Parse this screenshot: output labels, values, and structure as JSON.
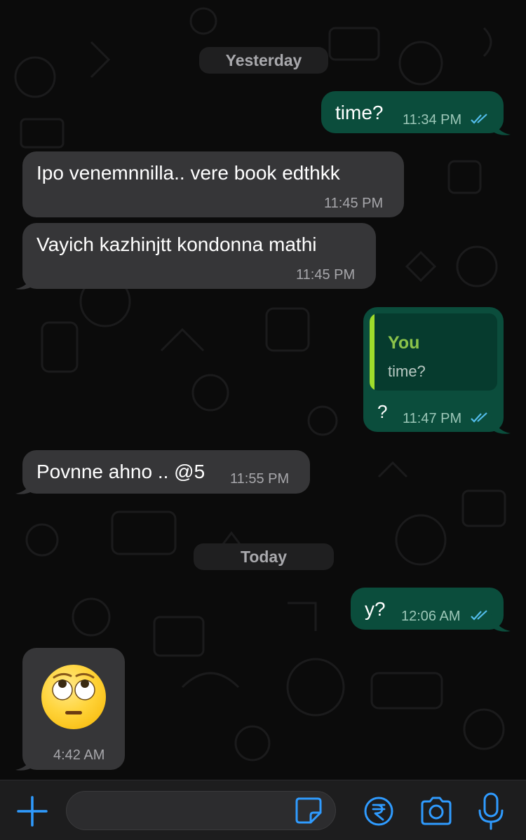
{
  "chat": {
    "date_separators": {
      "yesterday": "Yesterday",
      "today": "Today"
    },
    "messages": [
      {
        "direction": "outgoing",
        "text": "time?",
        "time": "11:34 PM",
        "status": "read"
      },
      {
        "direction": "incoming",
        "text": "Ipo venemnnilla.. vere book edthkk",
        "time": "11:45 PM"
      },
      {
        "direction": "incoming",
        "text": "Vayich kazhinjtt kondonna mathi",
        "time": "11:45 PM"
      },
      {
        "direction": "outgoing",
        "quote": {
          "author": "You",
          "text": "time?"
        },
        "text": "?",
        "time": "11:47 PM",
        "status": "read"
      },
      {
        "direction": "incoming",
        "text": "Povnne ahno .. @5",
        "time": "11:55 PM"
      },
      {
        "direction": "outgoing",
        "text": "y?",
        "time": "12:06 AM",
        "status": "read"
      },
      {
        "direction": "incoming",
        "emoji": "face-with-rolling-eyes",
        "time": "4:42 AM"
      }
    ]
  },
  "composer": {
    "input_value": "",
    "icons": [
      "plus-icon",
      "sticker-icon",
      "rupee-payment-icon",
      "camera-icon",
      "microphone-icon"
    ]
  },
  "colors": {
    "background": "#0b0b0b",
    "incoming_bubble": "#363638",
    "outgoing_bubble": "#0b4d3c",
    "read_ticks": "#53bdeb",
    "quote_author": "#8bc34a",
    "accent_icons": "#2f9bff"
  }
}
